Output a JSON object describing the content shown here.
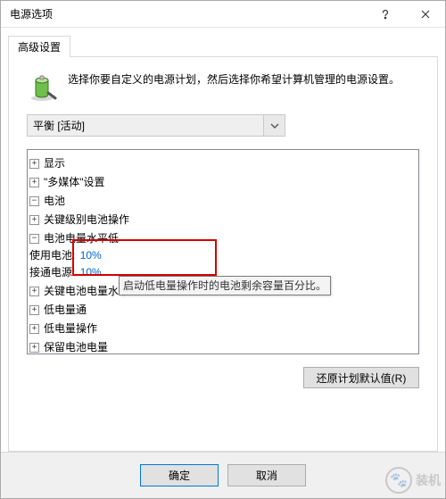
{
  "window": {
    "title": "电源选项"
  },
  "tab": {
    "label": "高级设置"
  },
  "intro": {
    "text": "选择你要自定义的电源计划，然后选择你希望计算机管理的电源设置。"
  },
  "plan_selector": {
    "value": "平衡 [活动]"
  },
  "tree": {
    "display": "显示",
    "multimedia": "\"多媒体\"设置",
    "battery": "电池",
    "battery_children": {
      "critical_action": "关键级别电池操作",
      "low_level": "电池电量水平低",
      "low_level_children": {
        "on_battery_label": "使用电池:",
        "on_battery_value": "10%",
        "plugged_label": "接通电源:",
        "plugged_value": "10%"
      },
      "critical_level": "关键电池电量水平",
      "low_notify": "低电量通",
      "low_action": "低电量操作",
      "reserve": "保留电池电量"
    }
  },
  "tooltip": {
    "text": "启动低电量操作时的电池剩余容量百分比。"
  },
  "buttons": {
    "restore": "还原计划默认值(R)",
    "ok": "确定",
    "cancel": "取消"
  },
  "watermark": {
    "text": "装机"
  }
}
